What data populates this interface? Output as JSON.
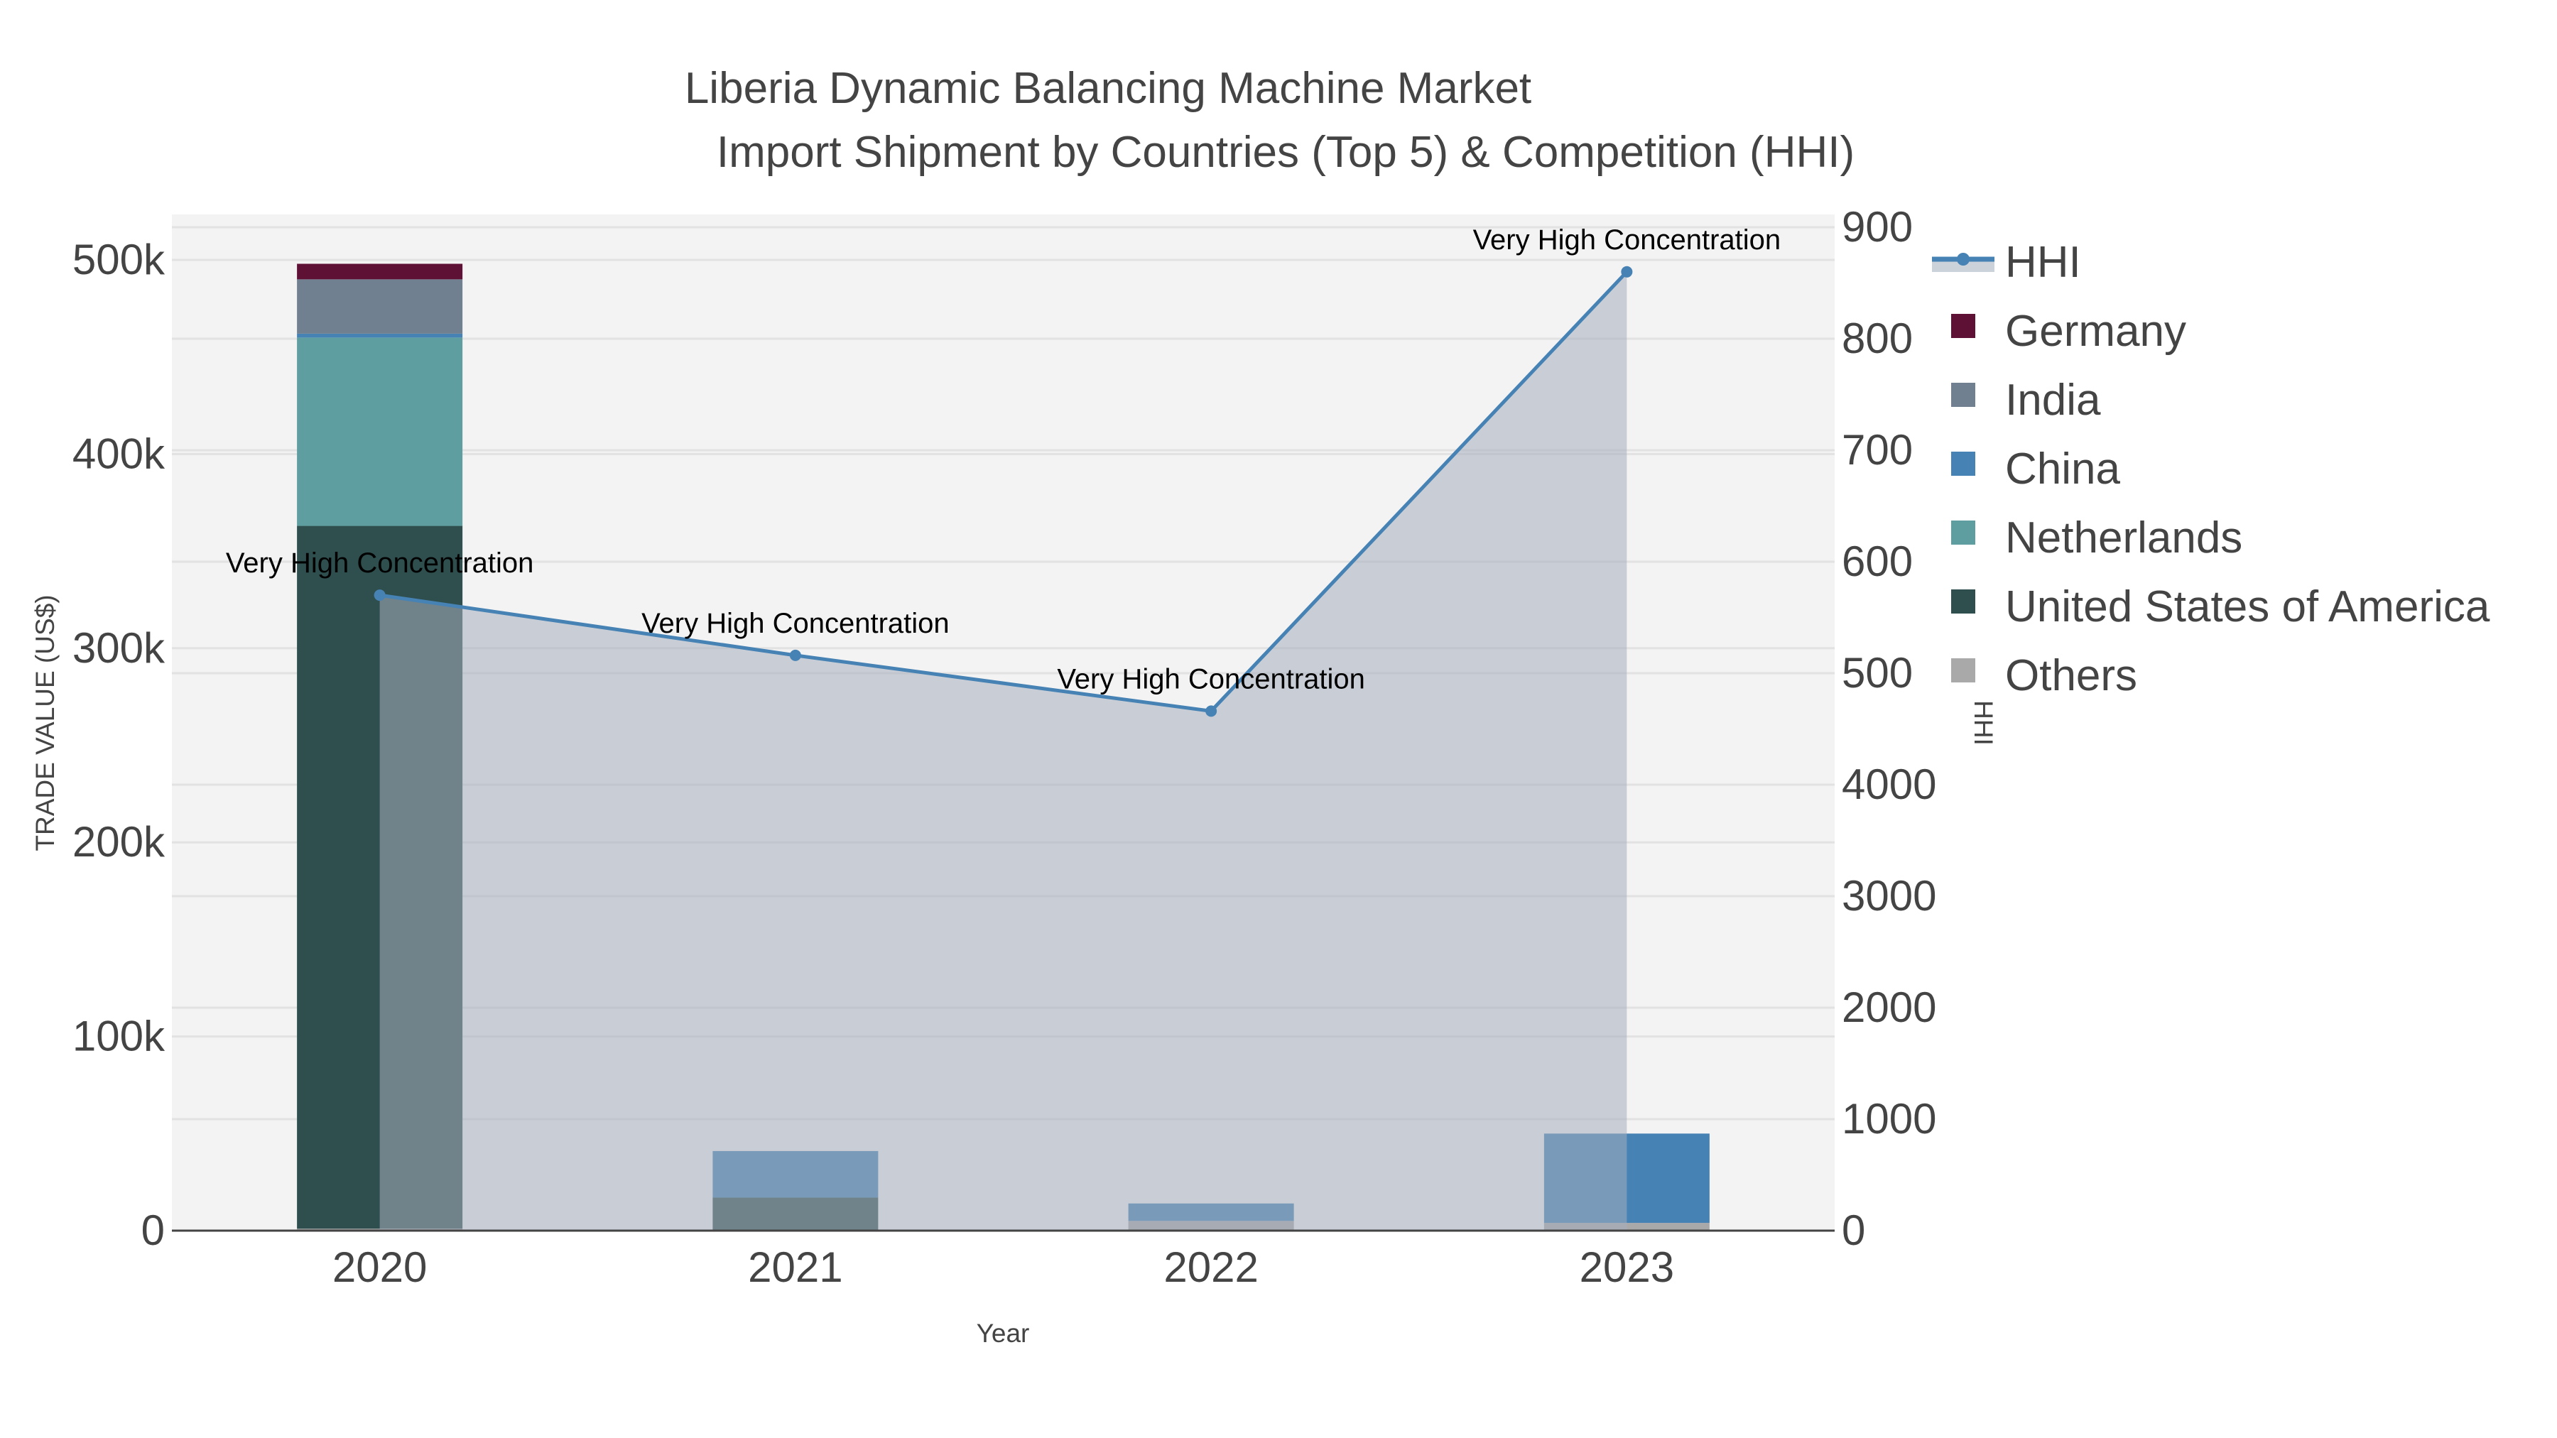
{
  "chart_data": {
    "type": "bar",
    "title": "Liberia Dynamic Balancing Machine Market",
    "subtitle": "Import Shipment by Countries (Top 5) & Competition (HHI)",
    "xlabel": "Year",
    "ylabel": "TRADE VALUE (US$)",
    "y2label": "HHI",
    "categories": [
      "2020",
      "2021",
      "2022",
      "2023"
    ],
    "ylim": [
      0,
      525000
    ],
    "y2lim": [
      0,
      9250
    ],
    "yticks": [
      0,
      100000,
      200000,
      300000,
      400000,
      500000
    ],
    "ytick_labels": [
      "0",
      "100k",
      "200k",
      "300k",
      "400k",
      "500k"
    ],
    "y2ticks": [
      0,
      1000,
      2000,
      3000,
      4000,
      5000,
      6000,
      7000,
      8000,
      9000
    ],
    "y2tick_labels": [
      "0",
      "1000",
      "2000",
      "3000",
      "4000",
      "500",
      "600",
      "700",
      "800",
      "900"
    ],
    "series": [
      {
        "name": "Others",
        "color": "#A9A9A9",
        "values": [
          1000,
          0,
          5000,
          4000
        ]
      },
      {
        "name": "United States of America",
        "color": "#2F4F4F",
        "values": [
          362000,
          17000,
          0,
          0
        ]
      },
      {
        "name": "Netherlands",
        "color": "#5F9EA0",
        "values": [
          97000,
          0,
          0,
          0
        ]
      },
      {
        "name": "China",
        "color": "#4682B4",
        "values": [
          2000,
          24000,
          9000,
          46000
        ]
      },
      {
        "name": "India",
        "color": "#708090",
        "values": [
          28000,
          0,
          0,
          0
        ]
      },
      {
        "name": "Germany",
        "color": "#5F1135",
        "values": [
          8000,
          0,
          0,
          0
        ]
      }
    ],
    "hhi": {
      "name": "HHI",
      "color": "#4682B4",
      "values": [
        5700,
        5160,
        4660,
        8600
      ],
      "annotations": [
        "Very High Concentration",
        "Very High Concentration",
        "Very High Concentration",
        "Very High Concentration"
      ]
    },
    "legend": [
      "HHI",
      "Germany",
      "India",
      "China",
      "Netherlands",
      "United States of America",
      "Others"
    ],
    "legend_position": "right",
    "grid": true
  }
}
